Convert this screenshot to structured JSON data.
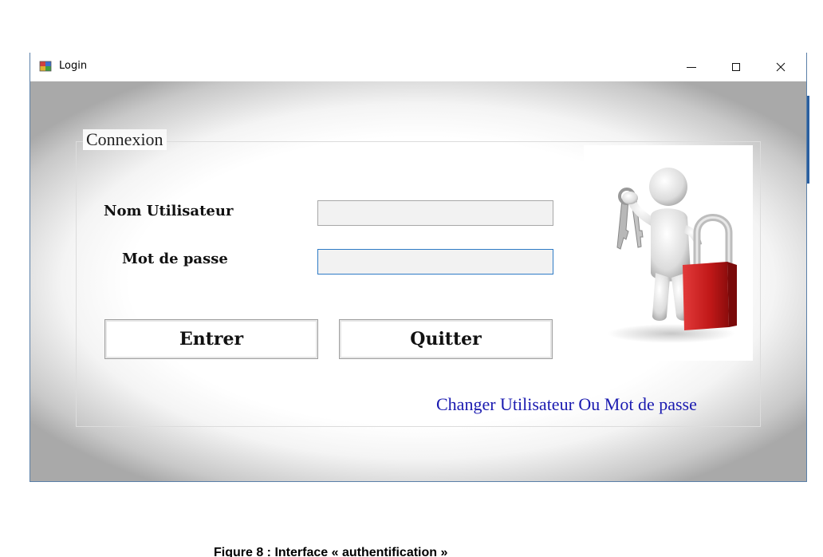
{
  "window": {
    "title": "Login",
    "controls": {
      "minimize": "minimize-icon",
      "maximize": "maximize-icon",
      "close": "close-icon"
    }
  },
  "form": {
    "group_title": "Connexion",
    "username_label": "Nom Utilisateur",
    "username_value": "",
    "password_label": "Mot de passe",
    "password_value": "",
    "enter_button": "Entrer",
    "quit_button": "Quitter",
    "change_link": "Changer Utilisateur Ou Mot de passe",
    "illustration": "person-with-keys-and-padlock-icon"
  },
  "caption": "Figure 8 : Interface « authentification »",
  "colors": {
    "link": "#1a1ab0",
    "focus_border": "#2f7bc6",
    "padlock": "#c81e1e",
    "frame_border": "#5a7fa8"
  }
}
